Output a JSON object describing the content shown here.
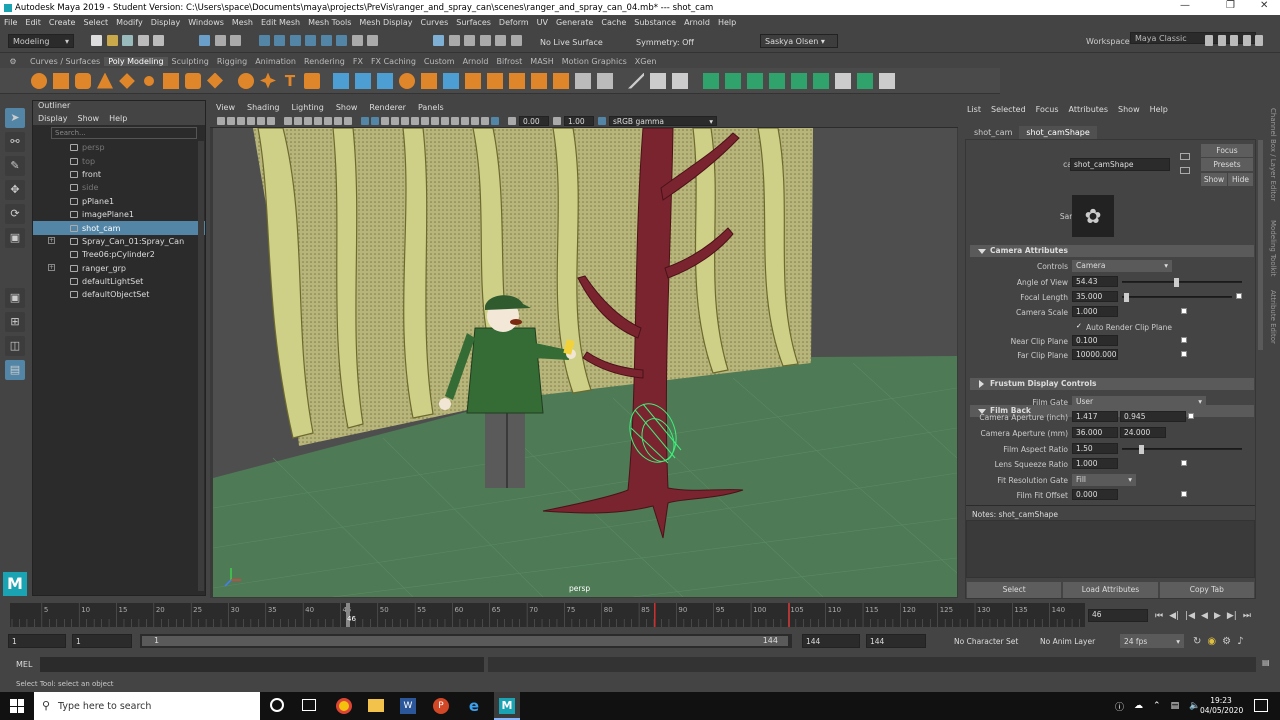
{
  "window": {
    "title": "Autodesk Maya 2019 - Student Version: C:\\Users\\space\\Documents\\maya\\projects\\PreVis\\ranger_and_spray_can\\scenes\\ranger_and_spray_can_04.mb*  ---  shot_cam"
  },
  "menubar": [
    "File",
    "Edit",
    "Create",
    "Select",
    "Modify",
    "Display",
    "Windows",
    "Mesh",
    "Edit Mesh",
    "Mesh Tools",
    "Mesh Display",
    "Curves",
    "Surfaces",
    "Deform",
    "UV",
    "Generate",
    "Cache",
    "Substance",
    "Arnold",
    "Help"
  ],
  "workspace": {
    "label": "Workspace :",
    "value": "Maya Classic"
  },
  "statusline": {
    "mode": "Modeling",
    "live_surface": "No Live Surface",
    "symmetry": "Symmetry: Off",
    "user": "Saskya Olsen"
  },
  "shelf_tabs": [
    "Curves / Surfaces",
    "Poly Modeling",
    "Sculpting",
    "Rigging",
    "Animation",
    "Rendering",
    "FX",
    "FX Caching",
    "Custom",
    "Arnold",
    "Bifrost",
    "MASH",
    "Motion Graphics",
    "XGen"
  ],
  "shelf_active": "Poly Modeling",
  "outliner": {
    "title": "Outliner",
    "menu": [
      "Display",
      "Show",
      "Help"
    ],
    "search_placeholder": "Search...",
    "items": [
      {
        "label": "persp",
        "dim": true,
        "type": "camera"
      },
      {
        "label": "top",
        "dim": true,
        "type": "camera"
      },
      {
        "label": "front",
        "dim": false,
        "type": "camera"
      },
      {
        "label": "side",
        "dim": true,
        "type": "camera"
      },
      {
        "label": "pPlane1",
        "dim": false,
        "type": "mesh"
      },
      {
        "label": "imagePlane1",
        "dim": false,
        "type": "image"
      },
      {
        "label": "shot_cam",
        "dim": false,
        "type": "camera",
        "selected": true
      },
      {
        "label": "Spray_Can_01:Spray_Can",
        "dim": false,
        "type": "group",
        "expand": true
      },
      {
        "label": "Tree06:pCylinder2",
        "dim": false,
        "type": "mesh"
      },
      {
        "label": "ranger_grp",
        "dim": false,
        "type": "group",
        "expand": true
      },
      {
        "label": "defaultLightSet",
        "dim": false,
        "type": "set"
      },
      {
        "label": "defaultObjectSet",
        "dim": false,
        "type": "set"
      }
    ]
  },
  "viewport": {
    "menu": [
      "View",
      "Shading",
      "Lighting",
      "Show",
      "Renderer",
      "Panels"
    ],
    "exposure": "0.00",
    "gamma": "1.00",
    "color_space": "sRGB gamma",
    "camera_label": "persp"
  },
  "attribute_editor": {
    "menu": [
      "List",
      "Selected",
      "Focus",
      "Attributes",
      "Show",
      "Help"
    ],
    "tabs": [
      "shot_cam",
      "shot_camShape"
    ],
    "active_tab": "shot_camShape",
    "camera_label": "camera:",
    "camera_value": "shot_camShape",
    "buttons": {
      "focus": "Focus",
      "presets": "Presets",
      "show": "Show",
      "hide": "Hide"
    },
    "sample_label": "Sample",
    "sections": {
      "camera_attributes": "Camera Attributes",
      "frustum": "Frustum Display Controls",
      "film_back": "Film Back"
    },
    "fields": {
      "controls_label": "Controls",
      "controls_value": "Camera",
      "aov_label": "Angle of View",
      "aov_value": "54.43",
      "aov_level": 0.45,
      "focal_label": "Focal Length",
      "focal_value": "35.000",
      "focal_level": 0.02,
      "scale_label": "Camera Scale",
      "scale_value": "1.000",
      "auto_clip_label": "Auto Render Clip Plane",
      "near_label": "Near Clip Plane",
      "near_value": "0.100",
      "far_label": "Far Clip Plane",
      "far_value": "10000.000",
      "gate_label": "Film Gate",
      "gate_value": "User",
      "ap_inch_label": "Camera Aperture (inch)",
      "ap_inch_1": "1.417",
      "ap_inch_2": "0.945",
      "ap_mm_label": "Camera Aperture (mm)",
      "ap_mm_1": "36.000",
      "ap_mm_2": "24.000",
      "ratio_label": "Film Aspect Ratio",
      "ratio_value": "1.50",
      "ratio_level": 0.15,
      "squeeze_label": "Lens Squeeze Ratio",
      "squeeze_value": "1.000",
      "resgate_label": "Fit Resolution Gate",
      "resgate_value": "Fill",
      "fitoffset_label": "Film Fit Offset",
      "fitoffset_value": "0.000"
    },
    "notes_label": "Notes:",
    "notes_value": "shot_camShape",
    "bottom_buttons": [
      "Select",
      "Load Attributes",
      "Copy Tab"
    ]
  },
  "timeline": {
    "ticks": [
      "5",
      "10",
      "15",
      "20",
      "25",
      "30",
      "35",
      "40",
      "45",
      "50",
      "55",
      "60",
      "65",
      "70",
      "75",
      "80",
      "85",
      "90",
      "95",
      "100",
      "105",
      "110",
      "115",
      "120",
      "125",
      "130",
      "135",
      "140"
    ],
    "current_frame_label": "46",
    "current_frame_field": "46"
  },
  "range": {
    "start": "1",
    "start2": "1",
    "range_start": "1",
    "range_end": "144",
    "end1": "144",
    "end2": "144",
    "character_set": "No Character Set",
    "anim_layer": "No Anim Layer",
    "fps": "24 fps"
  },
  "cmdline": {
    "label": "MEL"
  },
  "helpline": "Select Tool: select an object",
  "side_labels": [
    "Channel Box / Layer Editor",
    "Modeling Toolkit",
    "Attribute Editor"
  ],
  "taskbar": {
    "search_placeholder": "Type here to search",
    "time": "19:23",
    "date": "04/05/2020"
  }
}
